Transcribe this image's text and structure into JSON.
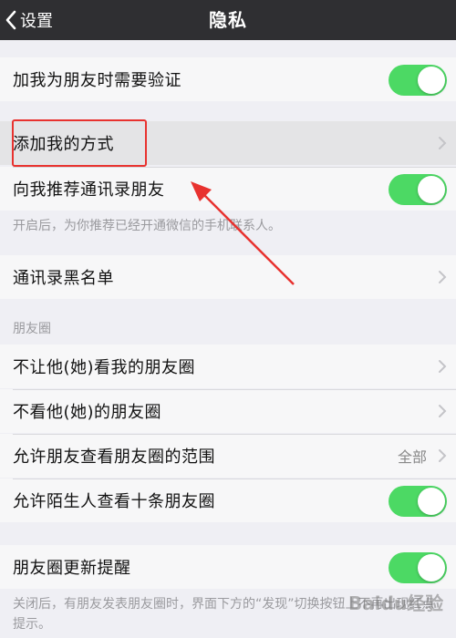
{
  "navbar": {
    "back_label": "设置",
    "title": "隐私"
  },
  "rows": {
    "verify": {
      "label": "加我为朋友时需要验证",
      "toggle_on": true
    },
    "add_me_ways": {
      "label": "添加我的方式"
    },
    "recommend_contacts": {
      "label": "向我推荐通讯录朋友",
      "toggle_on": true
    },
    "recommend_note": "开启后，为你推荐已经开通微信的手机联系人。",
    "blacklist": {
      "label": "通讯录黑名单"
    }
  },
  "moments": {
    "header": "朋友圈",
    "not_let_see": {
      "label": "不让他(她)看我的朋友圈"
    },
    "not_see": {
      "label": "不看他(她)的朋友圈"
    },
    "range": {
      "label": "允许朋友查看朋友圈的范围",
      "value": "全部"
    },
    "strangers": {
      "label": "允许陌生人查看十条朋友圈",
      "toggle_on": true
    }
  },
  "update_reminder": {
    "label": "朋友圈更新提醒",
    "toggle_on": true,
    "note": "关闭后，有朋友发表朋友圈时，界面下方的“发现”切换按钮上不再出现红点提示。"
  },
  "watermark": "Baidu经验",
  "colors": {
    "navbar": "#2f2f32",
    "toggle_on": "#4cd964",
    "annotation": "#e8322f"
  }
}
